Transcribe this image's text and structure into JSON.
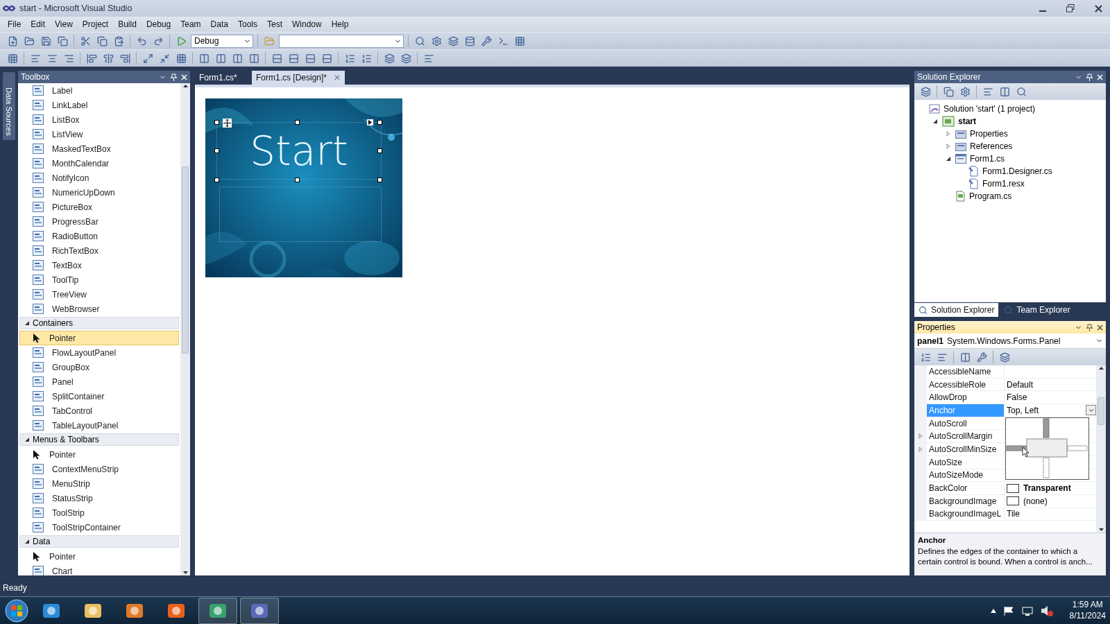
{
  "window": {
    "title": "start - Microsoft Visual Studio"
  },
  "menu": [
    "File",
    "Edit",
    "View",
    "Project",
    "Build",
    "Debug",
    "Team",
    "Data",
    "Tools",
    "Test",
    "Window",
    "Help"
  ],
  "toolbar": {
    "configuration": "Debug"
  },
  "side_tab": "Data Sources",
  "toolbox": {
    "title": "Toolbox",
    "rows": [
      {
        "kind": "item",
        "label": "Label",
        "selected": false
      },
      {
        "kind": "item",
        "label": "LinkLabel",
        "selected": false
      },
      {
        "kind": "item",
        "label": "ListBox",
        "selected": false
      },
      {
        "kind": "item",
        "label": "ListView",
        "selected": false
      },
      {
        "kind": "item",
        "label": "MaskedTextBox",
        "selected": false
      },
      {
        "kind": "item",
        "label": "MonthCalendar",
        "selected": false
      },
      {
        "kind": "item",
        "label": "NotifyIcon",
        "selected": false
      },
      {
        "kind": "item",
        "label": "NumericUpDown",
        "selected": false
      },
      {
        "kind": "item",
        "label": "PictureBox",
        "selected": false
      },
      {
        "kind": "item",
        "label": "ProgressBar",
        "selected": false
      },
      {
        "kind": "item",
        "label": "RadioButton",
        "selected": false
      },
      {
        "kind": "item",
        "label": "RichTextBox",
        "selected": false
      },
      {
        "kind": "item",
        "label": "TextBox",
        "selected": false
      },
      {
        "kind": "item",
        "label": "ToolTip",
        "selected": false
      },
      {
        "kind": "item",
        "label": "TreeView",
        "selected": false
      },
      {
        "kind": "item",
        "label": "WebBrowser",
        "selected": false
      },
      {
        "kind": "group",
        "label": "Containers",
        "expanded": true
      },
      {
        "kind": "pointer",
        "label": "Pointer",
        "selected": true
      },
      {
        "kind": "item",
        "label": "FlowLayoutPanel",
        "selected": false
      },
      {
        "kind": "item",
        "label": "GroupBox",
        "selected": false
      },
      {
        "kind": "item",
        "label": "Panel",
        "selected": false
      },
      {
        "kind": "item",
        "label": "SplitContainer",
        "selected": false
      },
      {
        "kind": "item",
        "label": "TabControl",
        "selected": false
      },
      {
        "kind": "item",
        "label": "TableLayoutPanel",
        "selected": false
      },
      {
        "kind": "group",
        "label": "Menus & Toolbars",
        "expanded": true
      },
      {
        "kind": "pointer",
        "label": "Pointer",
        "selected": false
      },
      {
        "kind": "item",
        "label": "ContextMenuStrip",
        "selected": false
      },
      {
        "kind": "item",
        "label": "MenuStrip",
        "selected": false
      },
      {
        "kind": "item",
        "label": "StatusStrip",
        "selected": false
      },
      {
        "kind": "item",
        "label": "ToolStrip",
        "selected": false
      },
      {
        "kind": "item",
        "label": "ToolStripContainer",
        "selected": false
      },
      {
        "kind": "group",
        "label": "Data",
        "expanded": true
      },
      {
        "kind": "pointer",
        "label": "Pointer",
        "selected": false
      },
      {
        "kind": "item",
        "label": "Chart",
        "selected": false
      }
    ]
  },
  "documents": {
    "tabs": [
      {
        "label": "Form1.cs*",
        "selected": false
      },
      {
        "label": "Form1.cs [Design]*",
        "selected": true
      }
    ],
    "close": "✕",
    "form": {
      "kind": "picture",
      "label_text": "Start"
    }
  },
  "solution_explorer": {
    "title": "Solution Explorer",
    "tree": [
      {
        "kind": "solution",
        "label": "Solution 'start' (1 project)",
        "children": [
          {
            "kind": "project",
            "label": "start",
            "expanded": true,
            "children": [
              {
                "kind": "folder",
                "label": "Properties",
                "expanded": false
              },
              {
                "kind": "folder",
                "label": "References",
                "expanded": false
              },
              {
                "kind": "form",
                "label": "Form1.cs",
                "expanded": true,
                "children": [
                  {
                    "kind": "file",
                    "label": "Form1.Designer.cs"
                  },
                  {
                    "kind": "file",
                    "label": "Form1.resx"
                  }
                ]
              },
              {
                "kind": "code",
                "label": "Program.cs"
              }
            ]
          }
        ]
      }
    ],
    "tabs": [
      {
        "label": "Solution Explorer",
        "selected": true
      },
      {
        "label": "Team Explorer",
        "selected": false
      }
    ]
  },
  "properties": {
    "title": "Properties",
    "object_name": "panel1",
    "object_type": "System.Windows.Forms.Panel",
    "rows": [
      {
        "kind": "text",
        "name": "AccessibleName",
        "selected": false
      },
      {
        "kind": "text",
        "name": "AccessibleRole",
        "value": "Default",
        "selected": false,
        "modified": false
      },
      {
        "kind": "text",
        "name": "AllowDrop",
        "value": "False",
        "selected": false,
        "modified": false
      },
      {
        "kind": "dropdown",
        "name": "Anchor",
        "value": "Top, Left",
        "selected": true
      },
      {
        "kind": "text",
        "name": "AutoScroll",
        "selected": false
      },
      {
        "kind": "text",
        "name": "AutoScrollMargin",
        "expanded": false,
        "selected": false
      },
      {
        "kind": "text",
        "name": "AutoScrollMinSize",
        "expanded": false,
        "selected": false
      },
      {
        "kind": "text",
        "name": "AutoSize",
        "selected": false
      },
      {
        "kind": "text",
        "name": "AutoSizeMode",
        "selected": false
      },
      {
        "kind": "swatch",
        "name": "BackColor",
        "value": "Transparent",
        "selected": false,
        "modified": true
      },
      {
        "kind": "swatch",
        "name": "BackgroundImage",
        "value": "(none)",
        "selected": false,
        "modified": false
      },
      {
        "kind": "text",
        "name": "BackgroundImageL",
        "value": "Tile",
        "selected": false,
        "modified": false
      }
    ],
    "anchor_editor": {
      "top": true,
      "left": true,
      "right": false,
      "bottom": false
    },
    "description": {
      "title": "Anchor",
      "text": "Defines the edges of the container to which a certain control is bound. When a control is anch..."
    }
  },
  "status_bar": "Ready",
  "taskbar": {
    "apps": [
      {
        "running": false
      },
      {
        "running": false
      },
      {
        "running": false
      },
      {
        "running": false
      },
      {
        "running": true
      },
      {
        "running": true
      }
    ],
    "time": "1:59 AM",
    "date": "8/11/2024"
  }
}
